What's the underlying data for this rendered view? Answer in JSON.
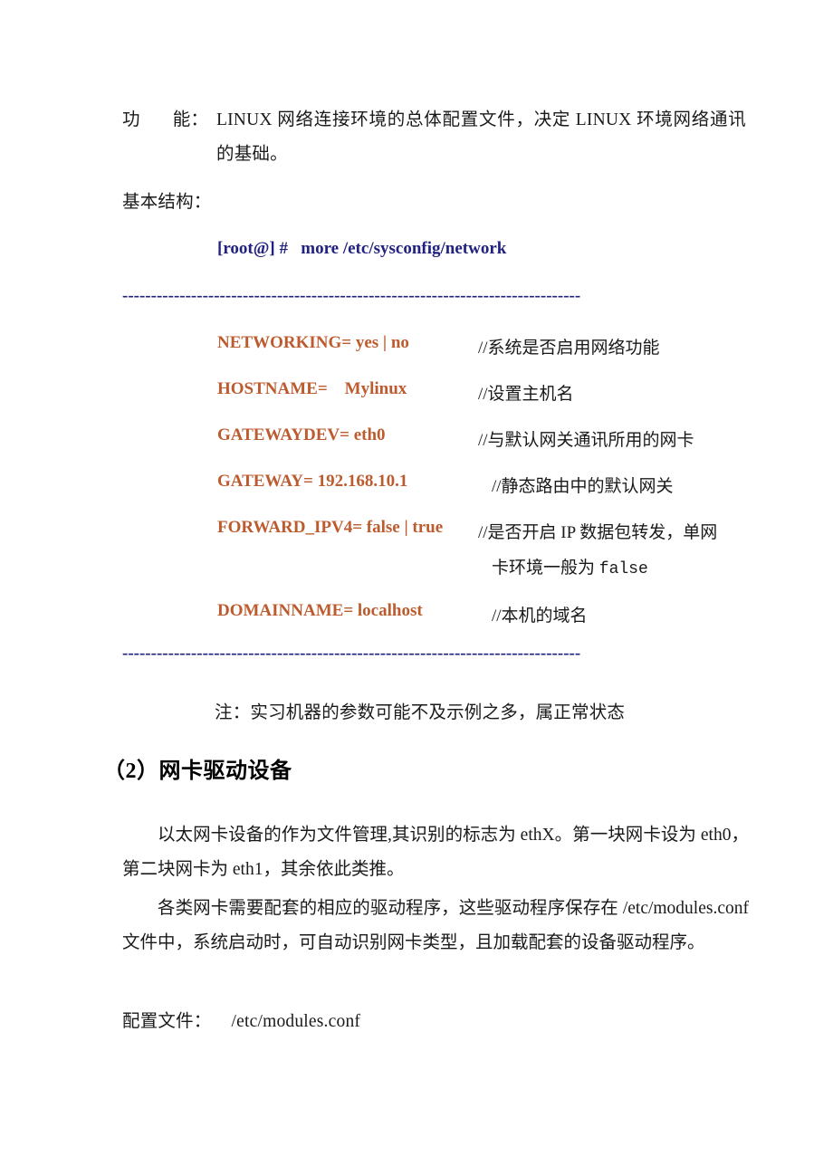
{
  "document": {
    "colors": {
      "command_blue": "#21217f",
      "config_key_orange": "#bc5b2e",
      "body_text": "#1a1a1a",
      "page_background": "#ffffff"
    },
    "definition": {
      "label_part1": "功",
      "label_part2": "能：",
      "text": "LINUX 网络连接环境的总体配置文件，决定 LINUX 环境网络通讯的基础。"
    },
    "basic_structure_label": "基本结构：",
    "command": "[root@] #   more /etc/sysconfig/network",
    "rule_dashes": "--------------------------------------------------------------------------------",
    "config_entries": [
      {
        "key": "NETWORKING= yes | no",
        "comment": "//系统是否启用网络功能",
        "comment_column": "a"
      },
      {
        "key": "HOSTNAME=    Mylinux",
        "comment": "//设置主机名",
        "comment_column": "a"
      },
      {
        "key": "GATEWAYDEV= eth0",
        "comment": "//与默认网关通讯所用的网卡",
        "comment_column": "a"
      },
      {
        "key": "GATEWAY= 192.168.10.1",
        "comment": "//静态路由中的默认网关",
        "comment_column": "b"
      },
      {
        "key": "FORWARD_IPV4= false | true",
        "comment": "//是否开启 IP 数据包转发，单网",
        "comment_column": "a"
      },
      {
        "key": "DOMAINNAME= localhost",
        "comment": "//本机的域名",
        "comment_column": "b"
      }
    ],
    "forward_comment_continuation_text": "卡环境一般为 ",
    "forward_comment_continuation_mono": "false",
    "note": "注：实习机器的参数可能不及示例之多，属正常状态",
    "heading": "（2）网卡驱动设备",
    "paragraph_1": "以太网卡设备的作为文件管理,其识别的标志为 ethX。第一块网卡设为 eth0，第二块网卡为 eth1，其余依此类推。",
    "paragraph_2": "各类网卡需要配套的相应的驱动程序，这些驱动程序保存在 /etc/modules.conf 文件中，系统启动时，可自动识别网卡类型，且加载配套的设备驱动程序。",
    "config_file_label": "配置文件：",
    "config_file_path": "/etc/modules.conf"
  }
}
